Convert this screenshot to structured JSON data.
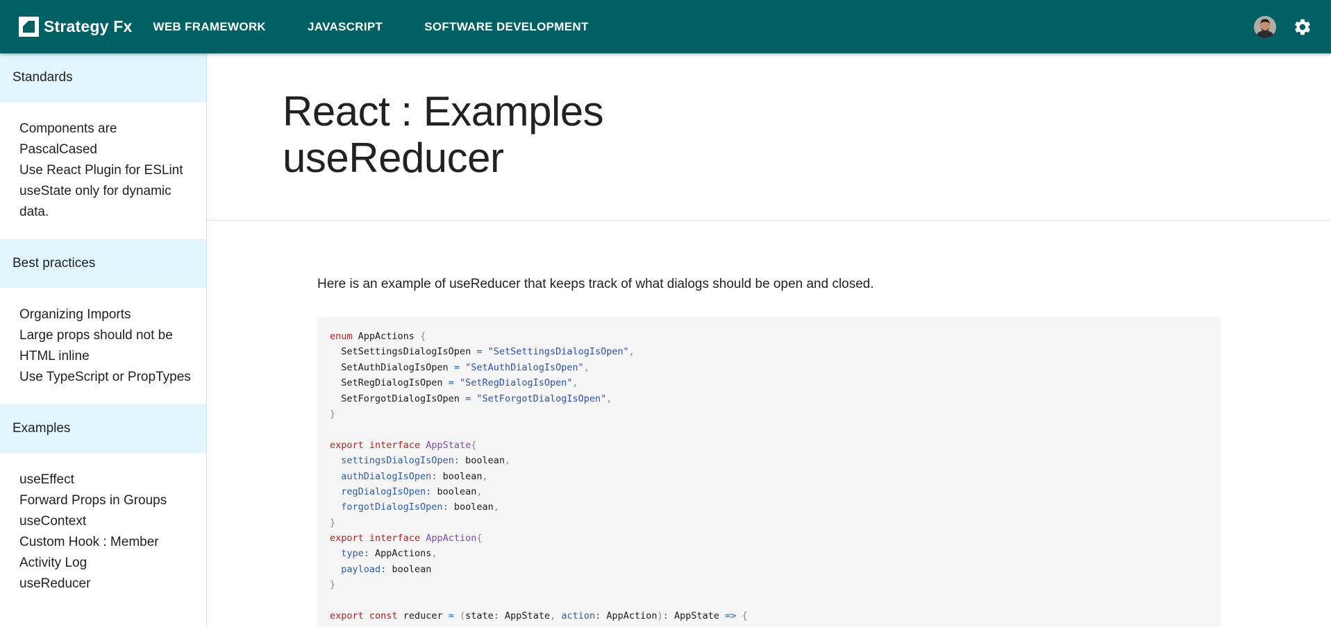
{
  "header": {
    "brand": "Strategy Fx",
    "nav": [
      "WEB FRAMEWORK",
      "JAVASCRIPT",
      "SOFTWARE DEVELOPMENT"
    ],
    "bar_color": "#006064"
  },
  "sidebar": {
    "sections": [
      {
        "title": "Standards",
        "items": [
          "Components are PascalCased",
          "Use React Plugin for ESLint",
          "useState only for dynamic data."
        ]
      },
      {
        "title": "Best practices",
        "items": [
          "Organizing Imports",
          "Large props should not be HTML inline",
          "Use TypeScript or PropTypes"
        ]
      },
      {
        "title": "Examples",
        "items": [
          "useEffect",
          "Forward Props in Groups",
          "useContext",
          "Custom Hook : Member Activity Log",
          "useReducer"
        ]
      }
    ],
    "section_color": "#e1f5fe"
  },
  "main": {
    "title_line1": "React : Examples",
    "title_line2": "useReducer",
    "intro": "Here is an example of useReducer that keeps track of what dialogs should be open and closed.",
    "code_lines": [
      [
        [
          "kw",
          "enum"
        ],
        [
          "id",
          " AppActions "
        ],
        [
          "punc",
          "{"
        ]
      ],
      [
        [
          "id",
          "  SetSettingsDialogIsOpen "
        ],
        [
          "op",
          "="
        ],
        [
          "str",
          " \"SetSettingsDialogIsOpen\""
        ],
        [
          "punc",
          ","
        ]
      ],
      [
        [
          "id",
          "  SetAuthDialogIsOpen "
        ],
        [
          "op",
          "="
        ],
        [
          "str",
          " \"SetAuthDialogIsOpen\""
        ],
        [
          "punc",
          ","
        ]
      ],
      [
        [
          "id",
          "  SetRegDialogIsOpen "
        ],
        [
          "op",
          "="
        ],
        [
          "str",
          " \"SetRegDialogIsOpen\""
        ],
        [
          "punc",
          ","
        ]
      ],
      [
        [
          "id",
          "  SetForgotDialogIsOpen "
        ],
        [
          "op",
          "="
        ],
        [
          "str",
          " \"SetForgotDialogIsOpen\""
        ],
        [
          "punc",
          ","
        ]
      ],
      [
        [
          "punc",
          "}"
        ]
      ],
      [],
      [
        [
          "kw",
          "export"
        ],
        [
          "id",
          " "
        ],
        [
          "kw",
          "interface"
        ],
        [
          "id",
          " "
        ],
        [
          "type",
          "AppState"
        ],
        [
          "punc",
          "{"
        ]
      ],
      [
        [
          "id",
          "  "
        ],
        [
          "prop",
          "settingsDialogIsOpen"
        ],
        [
          "op",
          ":"
        ],
        [
          "id",
          " boolean"
        ],
        [
          "punc",
          ","
        ]
      ],
      [
        [
          "id",
          "  "
        ],
        [
          "prop",
          "authDialogIsOpen"
        ],
        [
          "op",
          ":"
        ],
        [
          "id",
          " boolean"
        ],
        [
          "punc",
          ","
        ]
      ],
      [
        [
          "id",
          "  "
        ],
        [
          "prop",
          "regDialogIsOpen"
        ],
        [
          "op",
          ":"
        ],
        [
          "id",
          " boolean"
        ],
        [
          "punc",
          ","
        ]
      ],
      [
        [
          "id",
          "  "
        ],
        [
          "prop",
          "forgotDialogIsOpen"
        ],
        [
          "op",
          ":"
        ],
        [
          "id",
          " boolean"
        ],
        [
          "punc",
          ","
        ]
      ],
      [
        [
          "punc",
          "}"
        ]
      ],
      [
        [
          "kw",
          "export"
        ],
        [
          "id",
          " "
        ],
        [
          "kw",
          "interface"
        ],
        [
          "id",
          " "
        ],
        [
          "type",
          "AppAction"
        ],
        [
          "punc",
          "{"
        ]
      ],
      [
        [
          "id",
          "  "
        ],
        [
          "prop",
          "type"
        ],
        [
          "op",
          ":"
        ],
        [
          "id",
          " AppActions"
        ],
        [
          "punc",
          ","
        ]
      ],
      [
        [
          "id",
          "  "
        ],
        [
          "prop",
          "payload"
        ],
        [
          "op",
          ":"
        ],
        [
          "id",
          " boolean"
        ]
      ],
      [
        [
          "punc",
          "}"
        ]
      ],
      [],
      [
        [
          "kw",
          "export"
        ],
        [
          "id",
          " "
        ],
        [
          "kw",
          "const"
        ],
        [
          "id",
          " reducer "
        ],
        [
          "op",
          "="
        ],
        [
          "id",
          " "
        ],
        [
          "punc",
          "("
        ],
        [
          "id",
          "state"
        ],
        [
          "op",
          ":"
        ],
        [
          "id",
          " AppState"
        ],
        [
          "punc",
          ","
        ],
        [
          "id",
          " "
        ],
        [
          "prop",
          "action"
        ],
        [
          "op",
          ":"
        ],
        [
          "id",
          " AppAction"
        ],
        [
          "punc",
          ")"
        ],
        [
          "op",
          ":"
        ],
        [
          "id",
          " AppState "
        ],
        [
          "op",
          "=>"
        ],
        [
          "id",
          " "
        ],
        [
          "punc",
          "{"
        ]
      ]
    ]
  }
}
